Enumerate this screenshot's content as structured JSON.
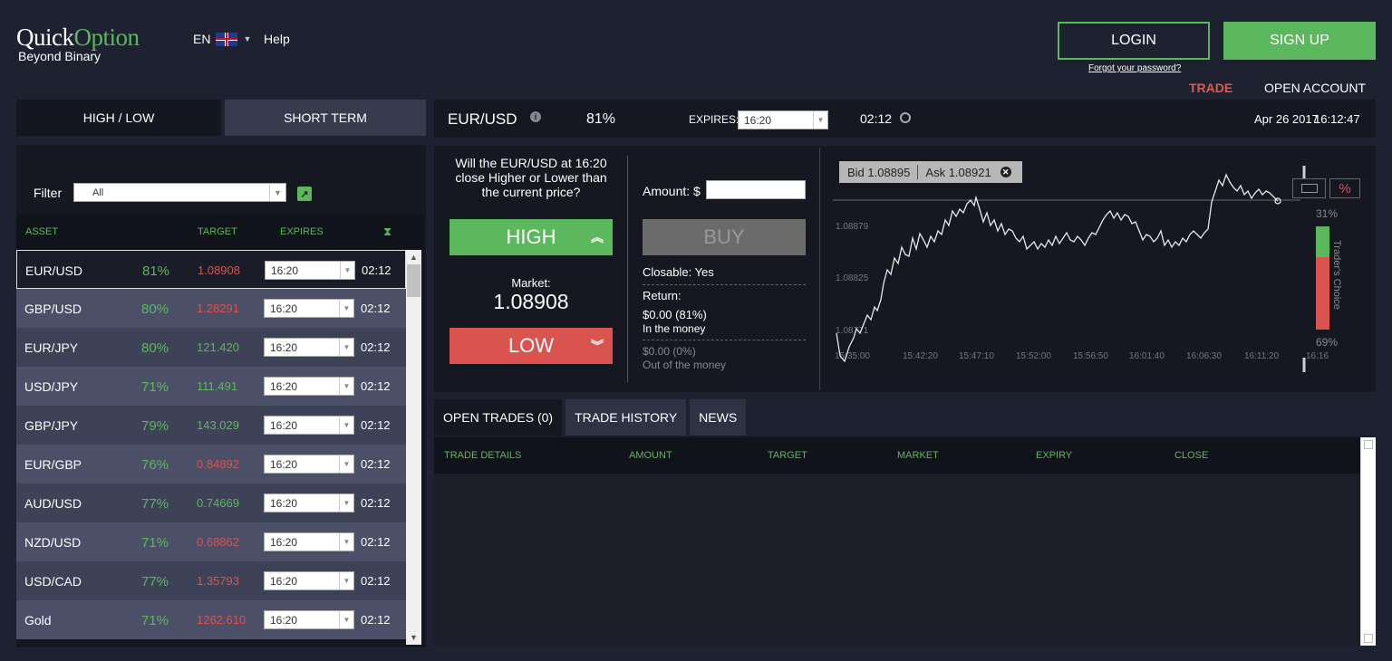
{
  "brand": {
    "name_part1": "Quick",
    "name_part2": "Option",
    "tagline": "Beyond Binary"
  },
  "header": {
    "lang": "EN",
    "help": "Help",
    "login": "LOGIN",
    "signup": "SIGN UP",
    "forgot": "Forgot your password?",
    "nav_trade": "TRADE",
    "nav_open_account": "OPEN ACCOUNT"
  },
  "left": {
    "tabs": [
      "HIGH / LOW",
      "SHORT TERM"
    ],
    "filter_label": "Filter",
    "filter_value": "All",
    "columns": [
      "ASSET",
      "TARGET",
      "EXPIRES"
    ],
    "rows": [
      {
        "asset": "EUR/USD",
        "pct": "81%",
        "target": "1.08908",
        "target_dir": "down",
        "expiry": "16:20",
        "time": "02:12"
      },
      {
        "asset": "GBP/USD",
        "pct": "80%",
        "target": "1.28291",
        "target_dir": "down",
        "expiry": "16:20",
        "time": "02:12"
      },
      {
        "asset": "EUR/JPY",
        "pct": "80%",
        "target": "121.420",
        "target_dir": "up",
        "expiry": "16:20",
        "time": "02:12"
      },
      {
        "asset": "USD/JPY",
        "pct": "71%",
        "target": "111.491",
        "target_dir": "up",
        "expiry": "16:20",
        "time": "02:12"
      },
      {
        "asset": "GBP/JPY",
        "pct": "79%",
        "target": "143.029",
        "target_dir": "up",
        "expiry": "16:20",
        "time": "02:12"
      },
      {
        "asset": "EUR/GBP",
        "pct": "76%",
        "target": "0.84892",
        "target_dir": "down",
        "expiry": "16:20",
        "time": "02:12"
      },
      {
        "asset": "AUD/USD",
        "pct": "77%",
        "target": "0.74669",
        "target_dir": "up",
        "expiry": "16:20",
        "time": "02:12"
      },
      {
        "asset": "NZD/USD",
        "pct": "71%",
        "target": "0.68862",
        "target_dir": "down",
        "expiry": "16:20",
        "time": "02:12"
      },
      {
        "asset": "USD/CAD",
        "pct": "77%",
        "target": "1.35793",
        "target_dir": "down",
        "expiry": "16:20",
        "time": "02:12"
      },
      {
        "asset": "Gold",
        "pct": "71%",
        "target": "1262.610",
        "target_dir": "down",
        "expiry": "16:20",
        "time": "02:12"
      }
    ]
  },
  "topbar": {
    "asset": "EUR/USD",
    "pct": "81%",
    "expires_label": "EXPIRES:",
    "expires_value": "16:20",
    "countdown": "02:12",
    "date": "Apr 26 2017",
    "time": "16:12:47"
  },
  "trade": {
    "question": "Will the EUR/USD at 16:20 close Higher or Lower than the current price?",
    "high": "HIGH",
    "low": "LOW",
    "market_label": "Market:",
    "market_value": "1.08908",
    "amount_label": "Amount: $",
    "buy": "BUY",
    "closable": "Closable: Yes",
    "return_label": "Return:",
    "return_value": "$0.00 (81%)",
    "in_money": "In the money",
    "out_value": "$0.00 (0%)",
    "out_money": "Out of the money"
  },
  "chart": {
    "bid": "Bid 1.08895",
    "ask": "Ask 1.08921",
    "y_labels": [
      "1.08879",
      "1.08825",
      "1.08771"
    ],
    "x_labels": [
      "15:35:00",
      "15:42:20",
      "15:47:10",
      "15:52:00",
      "15:56:50",
      "16:01:40",
      "16:06:30",
      "16:11:20",
      "16:16"
    ],
    "traders_choice": "Trader's Choice",
    "high_pct": "31%",
    "low_pct": "69%",
    "pct_tool": "%",
    "colors": {
      "up": "#5cb85c",
      "down": "#d9534f"
    }
  },
  "bottom": {
    "tabs": [
      "OPEN TRADES (0)",
      "TRADE HISTORY",
      "NEWS"
    ],
    "columns": [
      "TRADE DETAILS",
      "AMOUNT",
      "TARGET",
      "MARKET",
      "EXPIRY",
      "CLOSE"
    ]
  }
}
